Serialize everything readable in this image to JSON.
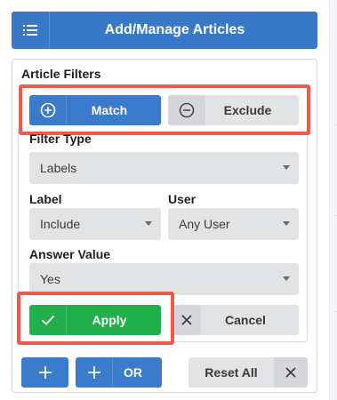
{
  "header": {
    "title": "Add/Manage Articles",
    "icon": "list-icon"
  },
  "filters": {
    "title": "Article Filters",
    "match_label": "Match",
    "exclude_label": "Exclude",
    "filter_type": {
      "label": "Filter Type",
      "value": "Labels"
    },
    "label_field": {
      "label": "Label",
      "value": "Include"
    },
    "user_field": {
      "label": "User",
      "value": "Any User"
    },
    "answer_field": {
      "label": "Answer Value",
      "value": "Yes"
    },
    "apply_label": "Apply",
    "cancel_label": "Cancel"
  },
  "footer": {
    "or_label": "OR",
    "reset_label": "Reset All"
  },
  "colors": {
    "primary": "#3a7bcb",
    "success": "#21b04b",
    "neutral": "#e2e3e5",
    "highlight": "#ef5a4c"
  }
}
